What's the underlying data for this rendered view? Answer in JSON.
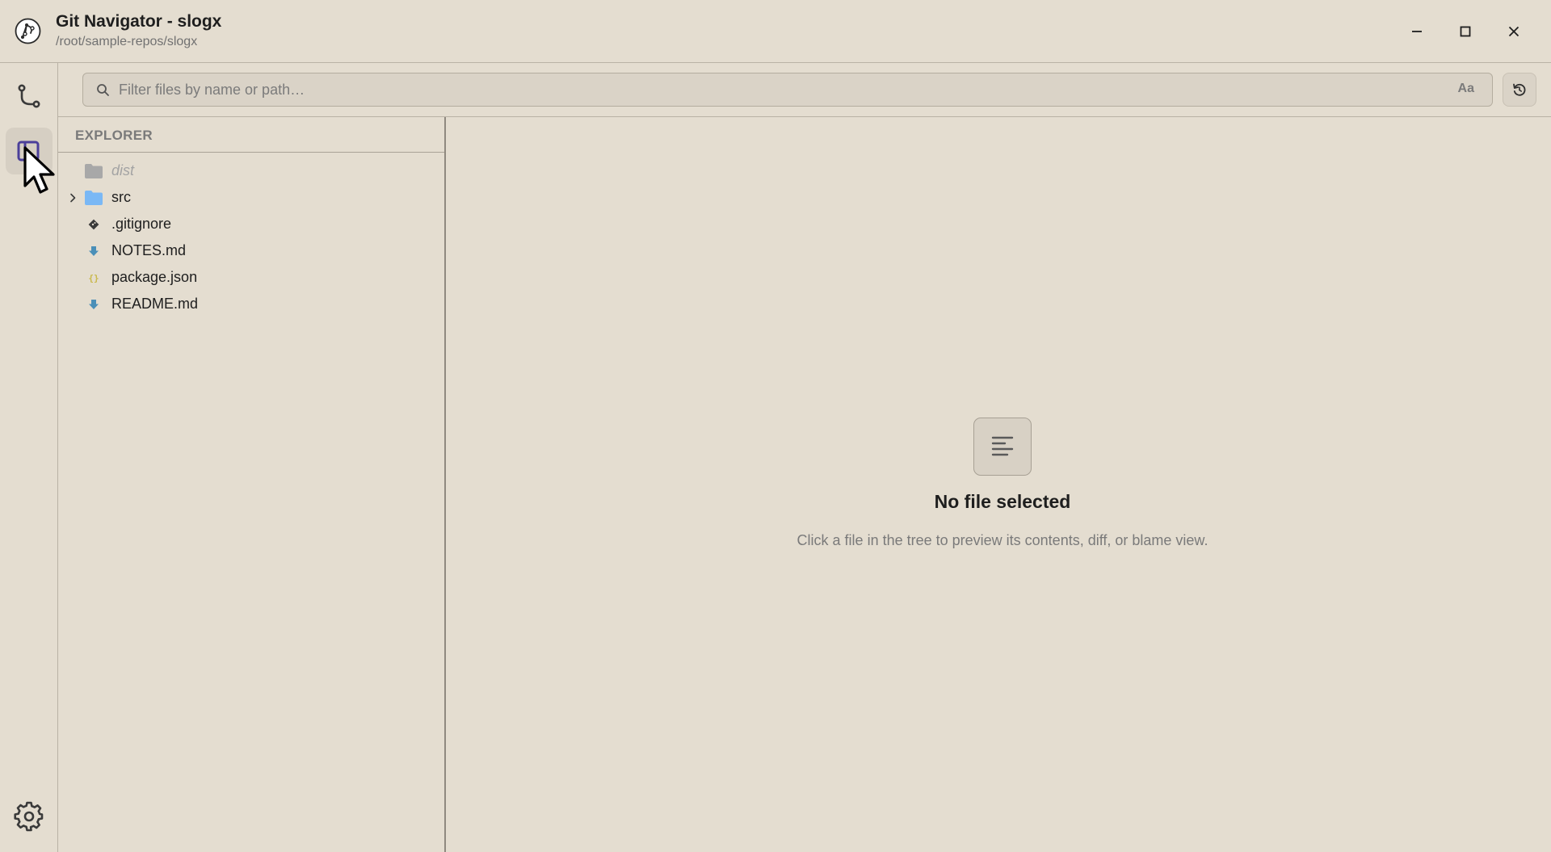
{
  "window": {
    "title": "Git Navigator - slogx",
    "path": "/root/sample-repos/slogx",
    "controls": [
      "minimize-icon",
      "maximize-icon",
      "close-icon"
    ]
  },
  "activity_bar": {
    "items": [
      {
        "icon": "git-branch-icon",
        "active": false
      },
      {
        "icon": "explorer-icon",
        "active": true
      },
      {
        "icon": "gear-icon",
        "active": false
      }
    ]
  },
  "filter": {
    "placeholder": "Filter files by name or path…",
    "value": "",
    "case_toggle_label": "Aa"
  },
  "explorer": {
    "header": "EXPLORER",
    "items": [
      {
        "name": "dist",
        "type": "folder",
        "ignored": true
      },
      {
        "name": "src",
        "type": "folder",
        "ignored": false,
        "expandable": true
      },
      {
        "name": ".gitignore",
        "type": "git-file"
      },
      {
        "name": "NOTES.md",
        "type": "markdown-file"
      },
      {
        "name": "package.json",
        "type": "json-file"
      },
      {
        "name": "README.md",
        "type": "markdown-file"
      }
    ]
  },
  "preview": {
    "empty_title": "No file selected",
    "empty_subtitle": "Click a file in the tree to preview its contents, diff, or blame view."
  },
  "colors": {
    "background": "#e4ddd0",
    "folder_blue": "#7ab8f5",
    "folder_gray": "#a8a8a8",
    "markdown_blue": "#4a8fb8",
    "json_yellow": "#c9b84a",
    "accent_purple": "#4b3f9a"
  }
}
